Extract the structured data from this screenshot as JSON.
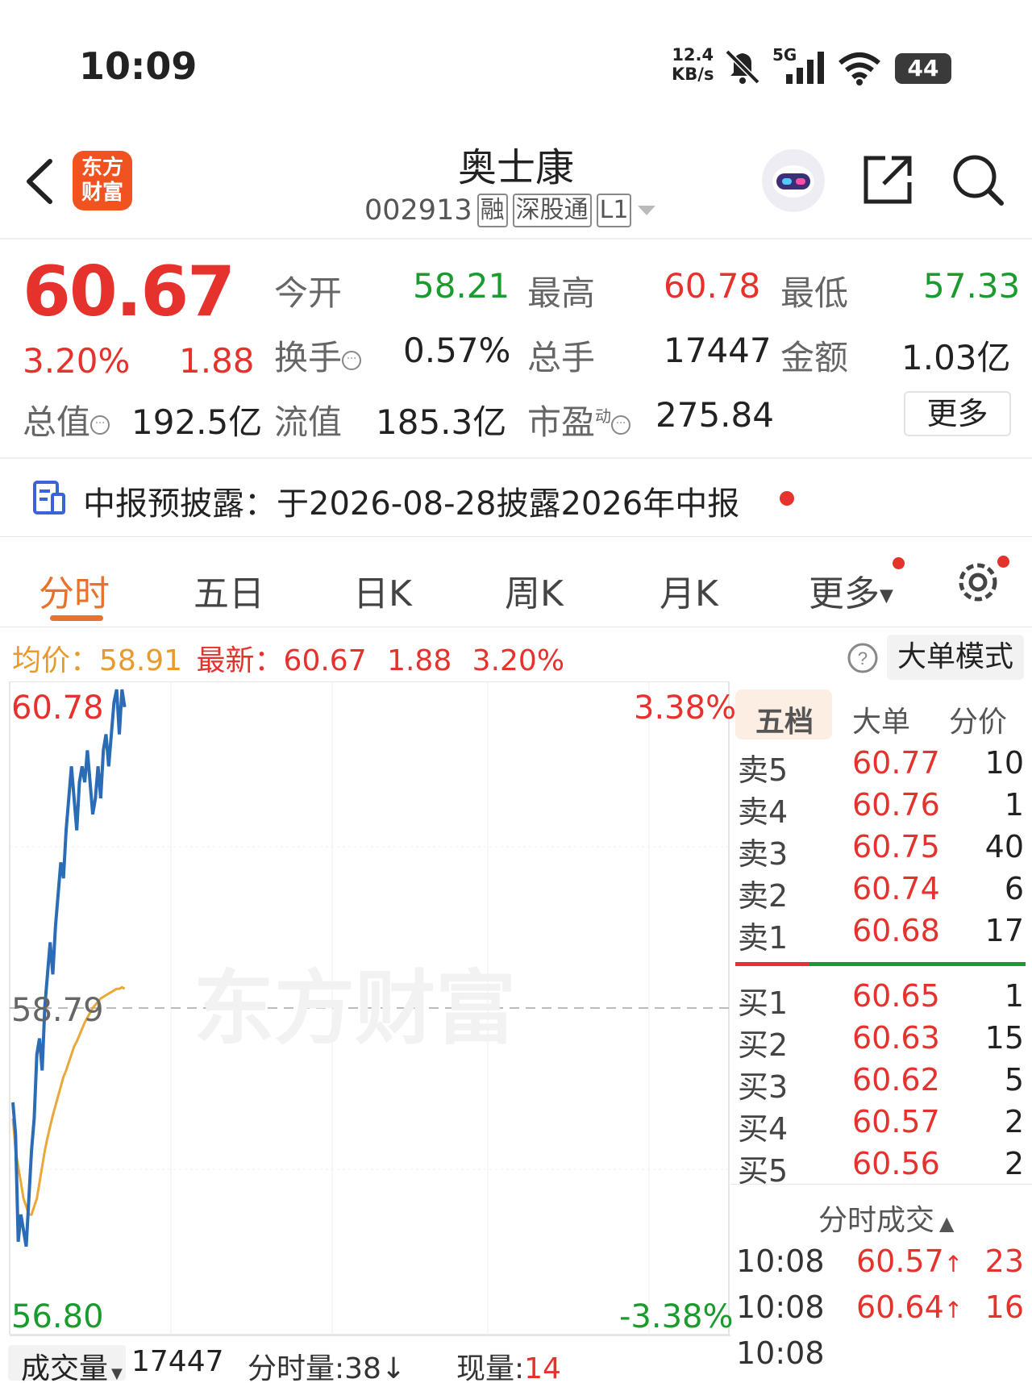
{
  "status_bar": {
    "time": "10:09",
    "net_speed_value": "12.4",
    "net_speed_unit": "KB/s",
    "signal_label": "5G",
    "battery": "44"
  },
  "header": {
    "logo_line1": "东方",
    "logo_line2": "财富",
    "stock_name": "奥士康",
    "stock_code": "002913",
    "tags": [
      "融",
      "深股通",
      "L1"
    ]
  },
  "quote": {
    "price": "60.67",
    "change_pct": "3.20%",
    "change": "1.88",
    "open_label": "今开",
    "open": "58.21",
    "high_label": "最高",
    "high": "60.78",
    "low_label": "最低",
    "low": "57.33",
    "turnover_label": "换手",
    "turnover": "0.57%",
    "volume_label": "总手",
    "volume": "17447",
    "amount_label": "金额",
    "amount": "1.03亿",
    "mktcap_label": "总值",
    "mktcap": "192.5亿",
    "float_label": "流值",
    "float_cap": "185.3亿",
    "pe_label": "市盈",
    "pe_sup": "动",
    "pe": "275.84",
    "more": "更多"
  },
  "notice": {
    "text": "中报预披露：于2026-08-28披露2026年中报"
  },
  "tabs": [
    "分时",
    "五日",
    "日K",
    "周K",
    "月K",
    "更多"
  ],
  "avg_row": {
    "avg_label": "均价：",
    "avg": "58.91",
    "latest_label": "最新：",
    "latest": "60.67",
    "change": "1.88",
    "change_pct": "3.20%",
    "big_order_mode": "大单模式"
  },
  "chart": {
    "watermark": "东方财富",
    "top_left": "60.78",
    "mid_left": "58.79",
    "bottom_left": "56.80",
    "top_right": "3.38%",
    "bottom_right": "-3.38%"
  },
  "chart_data": {
    "type": "line",
    "title": "",
    "ylim": [
      56.8,
      60.78
    ],
    "prev_close": 58.79,
    "series": [
      {
        "name": "",
        "values": [
          58.2,
          58.0,
          57.33,
          57.5,
          57.4,
          57.3,
          57.6,
          57.9,
          58.1,
          58.5,
          58.6,
          58.4,
          58.8,
          59.0,
          59.2,
          59.0,
          59.3,
          59.5,
          59.7,
          59.6,
          59.9,
          60.1,
          60.3,
          60.1,
          59.9,
          60.2,
          60.3,
          60.2,
          60.4,
          60.2,
          60.0,
          60.1,
          60.3,
          60.1,
          60.4,
          60.5,
          60.3,
          60.5,
          60.7,
          60.78,
          60.5,
          60.78,
          60.67
        ]
      },
      {
        "name": "",
        "values": [
          58.1,
          57.9,
          57.8,
          57.7,
          57.6,
          57.55,
          57.5,
          57.5,
          57.55,
          57.6,
          57.7,
          57.8,
          57.9,
          57.98,
          58.05,
          58.12,
          58.18,
          58.24,
          58.3,
          58.36,
          58.4,
          58.45,
          58.5,
          58.55,
          58.58,
          58.62,
          58.66,
          58.7,
          58.73,
          58.76,
          58.79,
          58.81,
          58.83,
          58.85,
          58.86,
          58.87,
          58.88,
          58.89,
          58.9,
          58.91,
          58.91,
          58.92,
          58.91
        ]
      }
    ]
  },
  "order_book": {
    "tabs": [
      "五档",
      "大单",
      "分价"
    ],
    "asks": [
      {
        "label": "卖5",
        "price": "60.77",
        "vol": "10"
      },
      {
        "label": "卖4",
        "price": "60.76",
        "vol": "1"
      },
      {
        "label": "卖3",
        "price": "60.75",
        "vol": "40"
      },
      {
        "label": "卖2",
        "price": "60.74",
        "vol": "6"
      },
      {
        "label": "卖1",
        "price": "60.68",
        "vol": "17"
      }
    ],
    "bids": [
      {
        "label": "买1",
        "price": "60.65",
        "vol": "1"
      },
      {
        "label": "买2",
        "price": "60.63",
        "vol": "15"
      },
      {
        "label": "买3",
        "price": "60.62",
        "vol": "5"
      },
      {
        "label": "买4",
        "price": "60.57",
        "vol": "2"
      },
      {
        "label": "买5",
        "price": "60.56",
        "vol": "2"
      }
    ],
    "ticks_title": "分时成交",
    "ticks": [
      {
        "time": "10:08",
        "price": "60.57",
        "vol": "23"
      },
      {
        "time": "10:08",
        "price": "60.64",
        "vol": "16"
      },
      {
        "time": "10:08",
        "price": "",
        "vol": ""
      }
    ]
  },
  "volume_bar": {
    "label": "成交量",
    "total": "17447",
    "minute_label": "分时量:",
    "minute_value": "38",
    "current_label": "现量:",
    "current_value": "14"
  },
  "colors": {
    "up": "#e5322d",
    "down": "#1a9b2d",
    "price_line": "#2b6cb7",
    "avg_line": "#e8a93a",
    "accent": "#e8722c"
  }
}
